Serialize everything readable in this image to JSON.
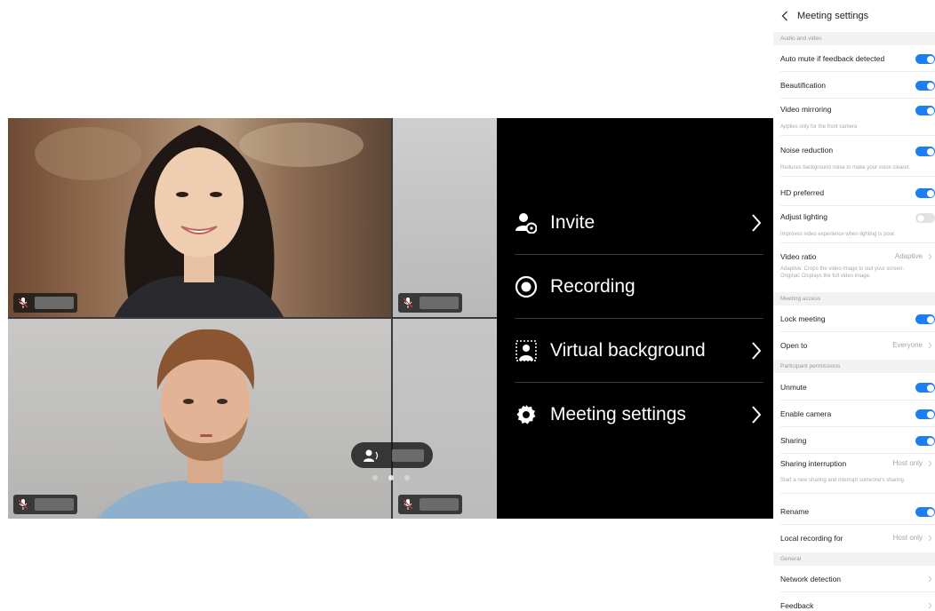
{
  "menu": {
    "items": [
      {
        "label": "Invite",
        "icon": "add-person-icon",
        "has_chevron": true
      },
      {
        "label": "Recording",
        "icon": "record-icon",
        "has_chevron": false
      },
      {
        "label": "Virtual background",
        "icon": "virtual-background-icon",
        "has_chevron": true
      },
      {
        "label": "Meeting settings",
        "icon": "gear-icon",
        "has_chevron": true
      }
    ]
  },
  "settings": {
    "title": "Meeting settings",
    "sections": {
      "audio_video": "Audio and video",
      "meeting_access": "Meeting access",
      "participant_permissions": "Participant permissions",
      "general": "General"
    },
    "rows": {
      "auto_mute": {
        "label": "Auto mute if feedback detected",
        "on": true
      },
      "beautification": {
        "label": "Beautification",
        "on": true
      },
      "video_mirroring": {
        "label": "Video mirroring",
        "sub": "Applies only for the front camera",
        "on": true
      },
      "noise_reduction": {
        "label": "Noise reduction",
        "sub": "Reduces background noise to make your voice clearer.",
        "on": true
      },
      "hd_preferred": {
        "label": "HD preferred",
        "on": true
      },
      "adjust_lighting": {
        "label": "Adjust lighting",
        "sub": "Improves video experience when lighting is poor.",
        "on": false
      },
      "video_ratio": {
        "label": "Video ratio",
        "value": "Adaptive",
        "sub1": "Adaptive: Crops the video image to suit your screen.",
        "sub2": "Original: Displays the full video image."
      },
      "lock_meeting": {
        "label": "Lock meeting",
        "on": true
      },
      "open_to": {
        "label": "Open to",
        "value": "Everyone"
      },
      "unmute": {
        "label": "Unmute",
        "on": true
      },
      "enable_camera": {
        "label": "Enable camera",
        "on": true
      },
      "sharing": {
        "label": "Sharing",
        "on": true
      },
      "sharing_interruption": {
        "label": "Sharing interruption",
        "value": "Host only",
        "sub": "Start a new sharing and interrupt someone's sharing."
      },
      "rename": {
        "label": "Rename",
        "on": true
      },
      "local_recording": {
        "label": "Local recording for",
        "value": "Host only"
      },
      "network_detection": {
        "label": "Network detection"
      },
      "feedback": {
        "label": "Feedback"
      }
    }
  },
  "colors": {
    "toggle_on": "#1e7ef0",
    "toggle_off": "#e3e3e3",
    "menu_bg": "#000000"
  }
}
